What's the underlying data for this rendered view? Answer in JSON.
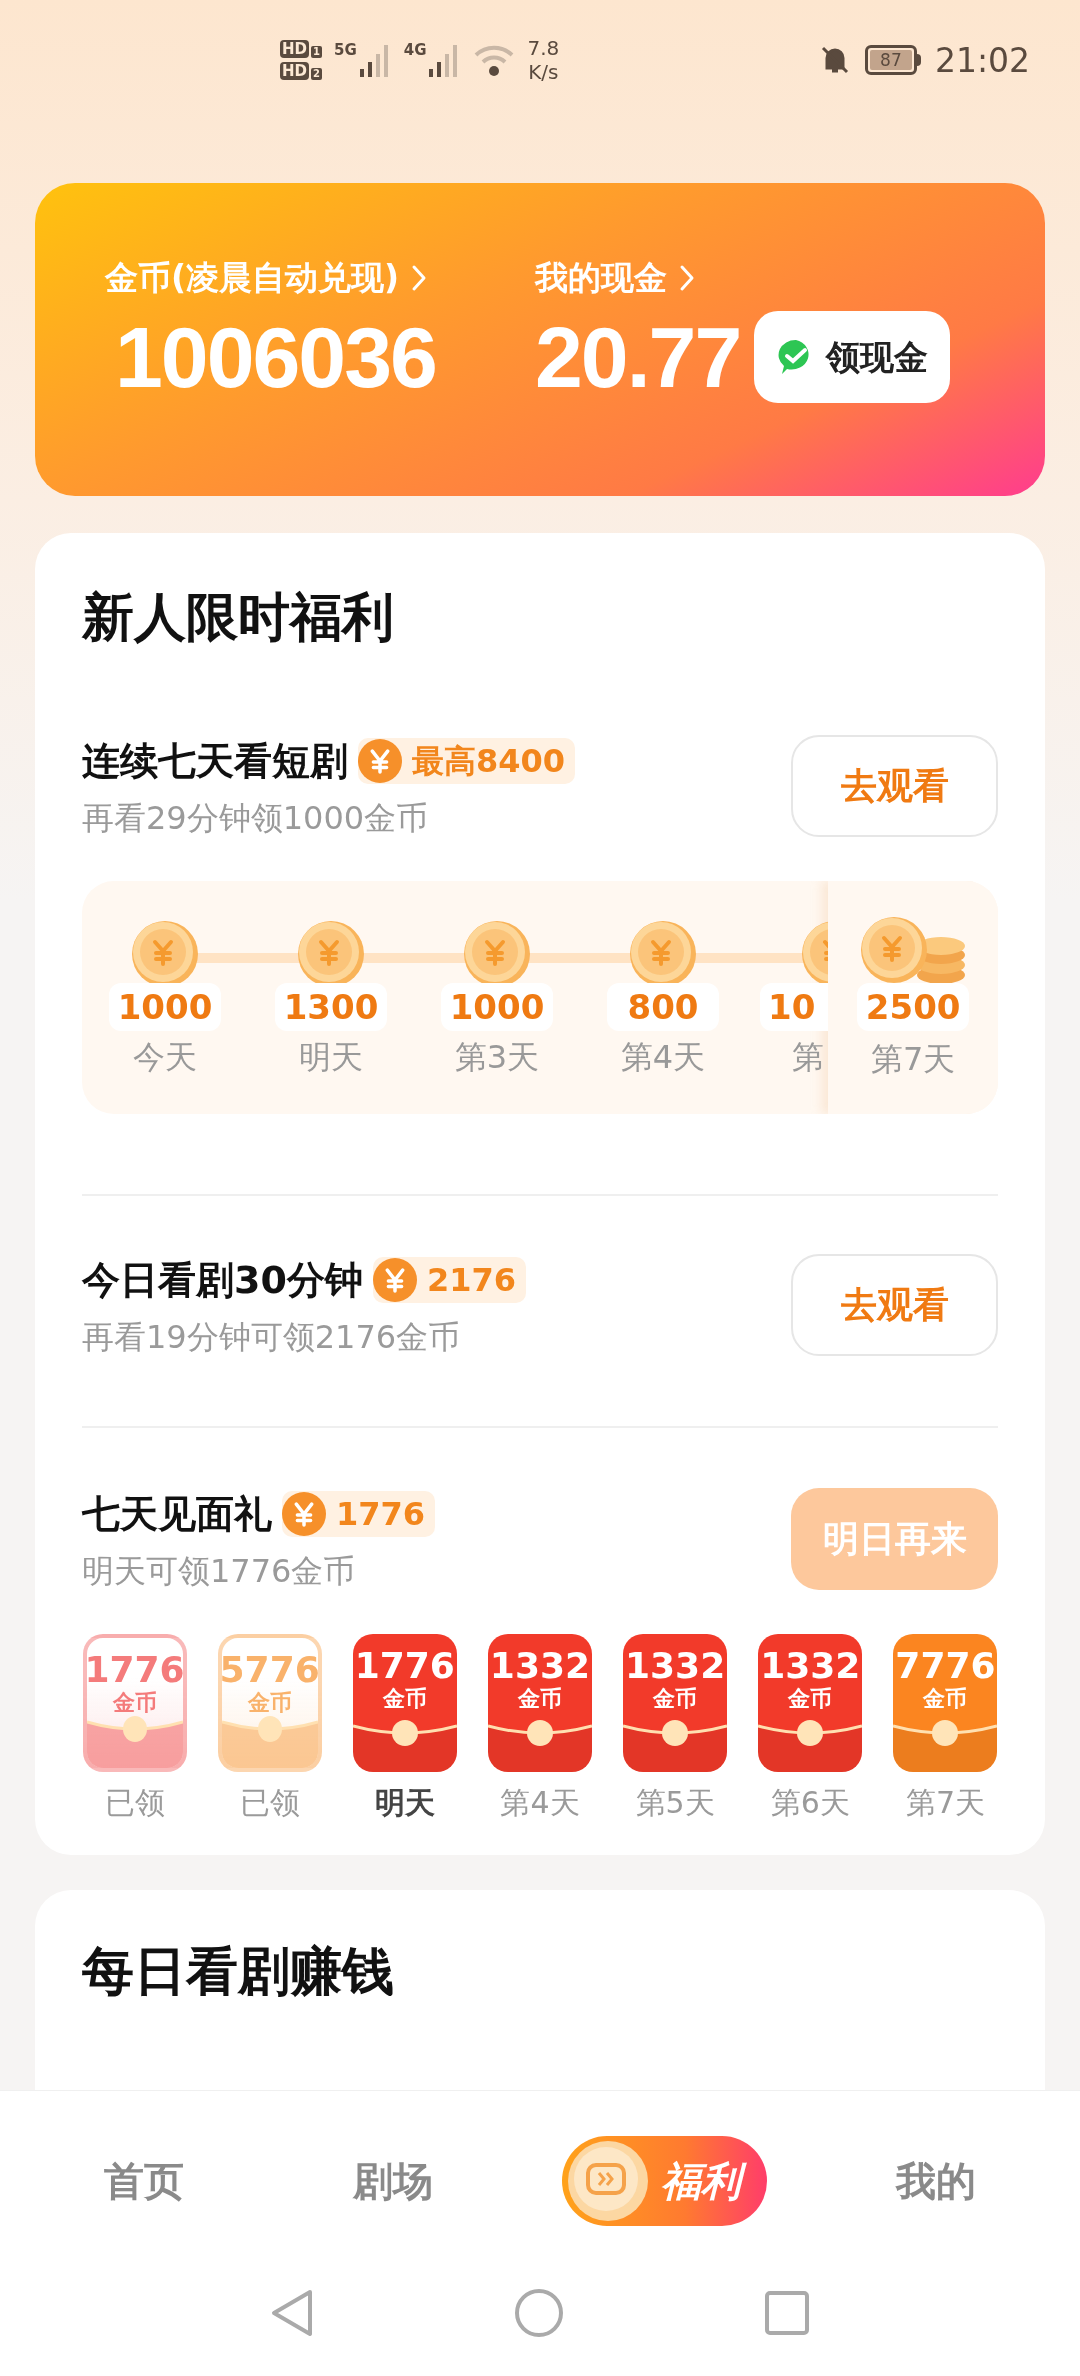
{
  "status_bar": {
    "sims": [
      {
        "badge": "HD",
        "slot": "1",
        "network": "5G"
      },
      {
        "badge": "HD",
        "slot": "2",
        "network": "4G"
      }
    ],
    "speed_value": "7.8",
    "speed_unit": "K/s",
    "battery": "87",
    "time": "21:02"
  },
  "wallet": {
    "coins_label": "金币(凌晨自动兑现)",
    "coins": "1006036",
    "cash_label": "我的现金",
    "cash": "20.77",
    "withdraw_button": "领现金"
  },
  "newcomer": {
    "title": "新人限时福利",
    "streak_task": {
      "title": "连续七天看短剧",
      "reward": "最高8400",
      "subtitle": "再看29分钟领1000金币",
      "button": {
        "label": "去观看",
        "disabled": false
      },
      "days": [
        {
          "amount": "1000",
          "label": "今天",
          "kind": "full"
        },
        {
          "amount": "1300",
          "label": "明天",
          "kind": "full"
        },
        {
          "amount": "1000",
          "label": "第3天",
          "kind": "full"
        },
        {
          "amount": "800",
          "label": "第4天",
          "kind": "full"
        },
        {
          "amount": "10",
          "label": "第",
          "kind": "partial"
        }
      ],
      "final_day": {
        "amount": "2500",
        "label": "第7天"
      }
    },
    "daily_task": {
      "title": "今日看剧30分钟",
      "reward": "2176",
      "subtitle": "再看19分钟可领2176金币",
      "button": {
        "label": "去观看",
        "disabled": false
      }
    },
    "gift_task": {
      "title": "七天见面礼",
      "reward": "1776",
      "subtitle": "明天可领1776金币",
      "button": {
        "label": "明日再来",
        "disabled": true
      },
      "packets": [
        {
          "amount": "1776",
          "unit": "金币",
          "label": "已领",
          "claimed": true,
          "current": false,
          "color": "#f47b7b"
        },
        {
          "amount": "5776",
          "unit": "金币",
          "label": "已领",
          "claimed": true,
          "current": false,
          "color": "#f9b26b"
        },
        {
          "amount": "1776",
          "unit": "金币",
          "label": "明天",
          "claimed": false,
          "current": true,
          "color": "#f23a2a"
        },
        {
          "amount": "1332",
          "unit": "金币",
          "label": "第4天",
          "claimed": false,
          "current": false,
          "color": "#f23a2a"
        },
        {
          "amount": "1332",
          "unit": "金币",
          "label": "第5天",
          "claimed": false,
          "current": false,
          "color": "#f23a2a"
        },
        {
          "amount": "1332",
          "unit": "金币",
          "label": "第6天",
          "claimed": false,
          "current": false,
          "color": "#f23a2a"
        },
        {
          "amount": "7776",
          "unit": "金币",
          "label": "第7天",
          "claimed": false,
          "current": false,
          "color": "#fb8520"
        }
      ]
    }
  },
  "daily_earn": {
    "title": "每日看剧赚钱"
  },
  "tabs": [
    {
      "label": "首页",
      "selected": false
    },
    {
      "label": "剧场",
      "selected": false
    },
    {
      "label": "福利",
      "selected": true
    },
    {
      "label": "我的",
      "selected": false
    }
  ]
}
